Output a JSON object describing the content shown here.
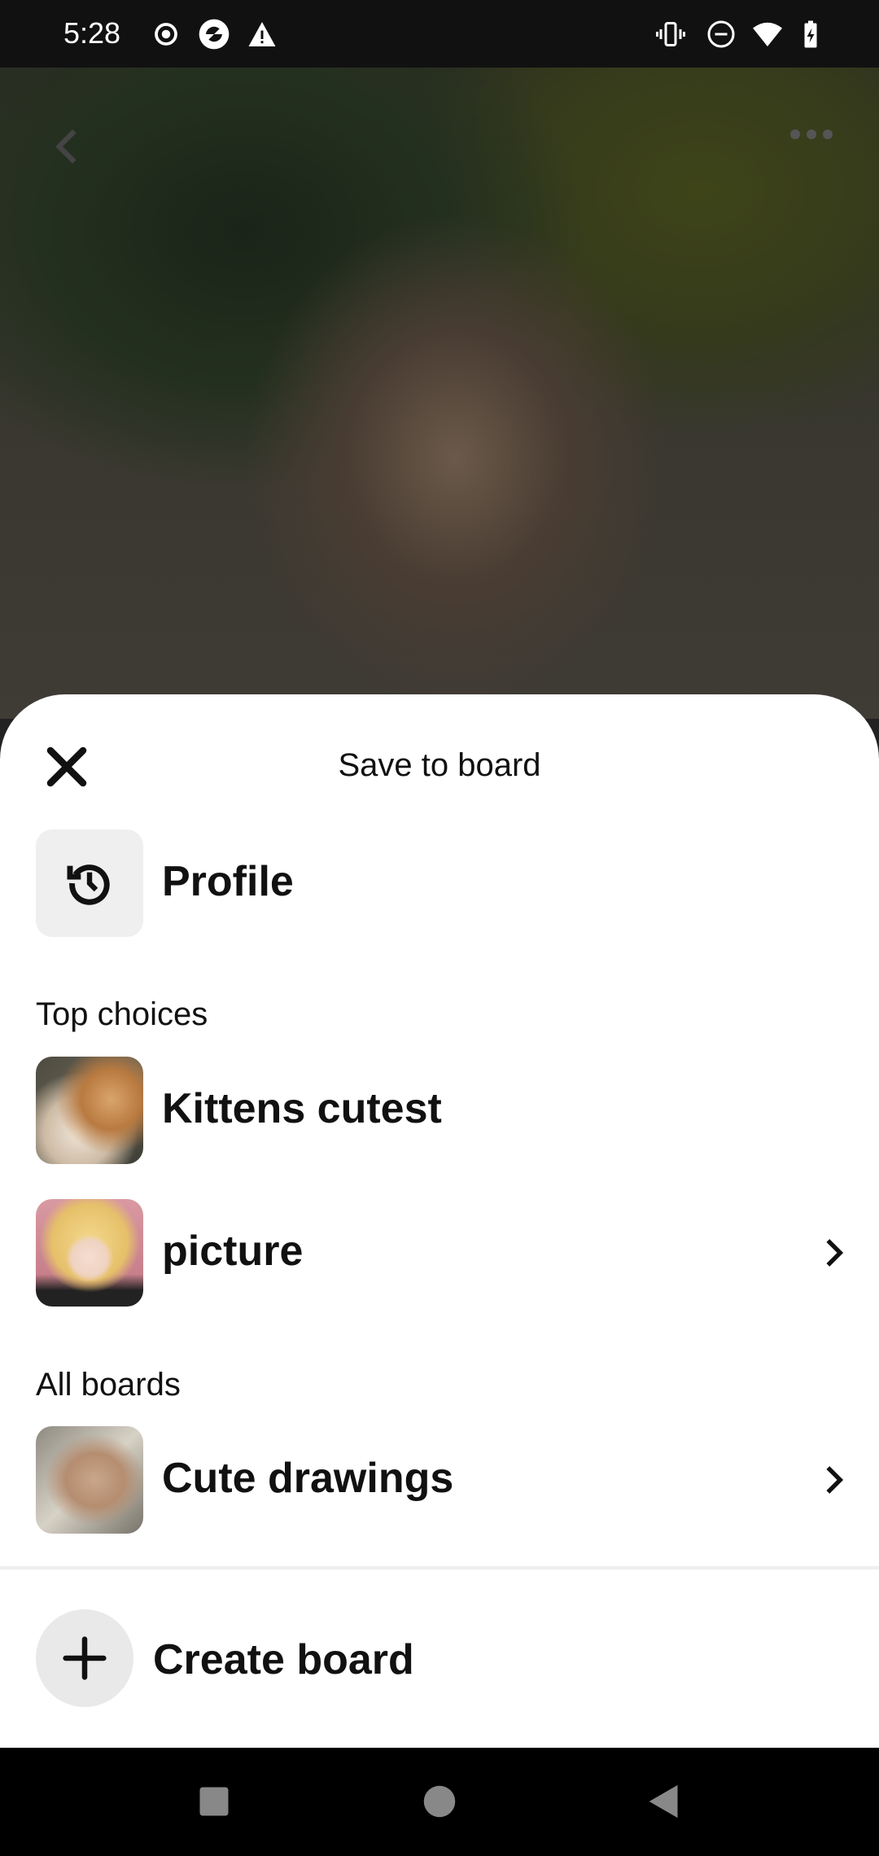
{
  "status_bar": {
    "time": "5:28",
    "icons": [
      "record-icon",
      "app-icon",
      "warning-icon",
      "vibrate-icon",
      "do-not-disturb-icon",
      "wifi-icon",
      "battery-charging-icon"
    ]
  },
  "sheet": {
    "title": "Save to board",
    "close_icon": "close-icon",
    "profile": {
      "label": "Profile",
      "icon": "history-icon"
    },
    "top_choices": {
      "heading": "Top choices",
      "items": [
        {
          "label": "Kittens cutest",
          "has_chevron": false
        },
        {
          "label": "picture",
          "has_chevron": true
        }
      ]
    },
    "all_boards": {
      "heading": "All boards",
      "items": [
        {
          "label": "Cute drawings",
          "has_chevron": true
        }
      ]
    },
    "create_board": {
      "label": "Create board"
    }
  },
  "nav_bar": {
    "buttons": [
      "recents",
      "home",
      "back"
    ]
  }
}
